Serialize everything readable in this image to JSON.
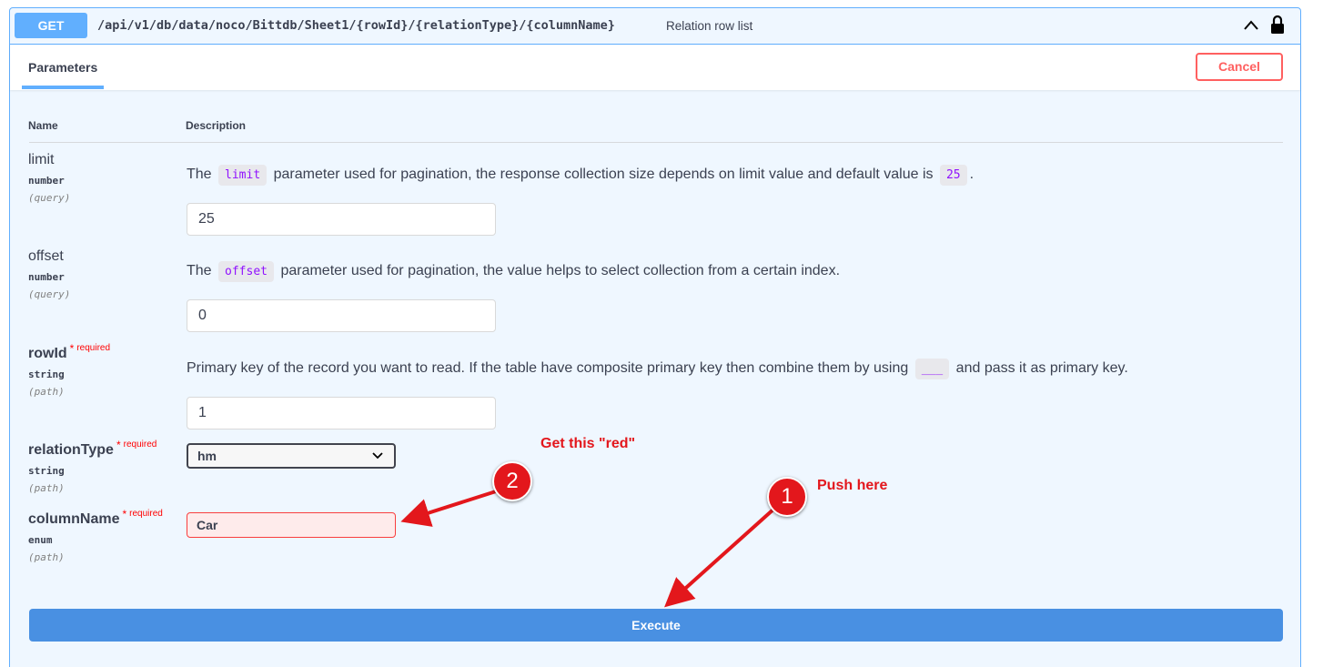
{
  "endpoint": {
    "method": "GET",
    "path": "/api/v1/db/data/noco/Bittdb/Sheet1/{rowId}/{relationType}/{columnName}",
    "summary": "Relation row list"
  },
  "tabs": {
    "parameters": "Parameters"
  },
  "buttons": {
    "cancel": "Cancel",
    "execute": "Execute"
  },
  "table_headers": {
    "name": "Name",
    "description": "Description"
  },
  "required_label": "required",
  "required_star": "*",
  "params": [
    {
      "name": "limit",
      "type": "number",
      "in": "(query)",
      "desc_pre": "The",
      "desc_code": "limit",
      "desc_post": "parameter used for pagination, the response collection size depends on limit value and default value is",
      "desc_code2": "25",
      "desc_end": ".",
      "value": "25"
    },
    {
      "name": "offset",
      "type": "number",
      "in": "(query)",
      "desc_pre": "The",
      "desc_code": "offset",
      "desc_post": "parameter used for pagination, the value helps to select collection from a certain index.",
      "value": "0"
    },
    {
      "name": "rowId",
      "type": "string",
      "in": "(path)",
      "desc_pre": "Primary key of the record you want to read. If the table have composite primary key then combine them by using",
      "desc_code": "___",
      "desc_post": "and pass it as primary key.",
      "value": "1"
    },
    {
      "name": "relationType",
      "type": "string",
      "in": "(path)",
      "selected": "hm"
    },
    {
      "name": "columnName",
      "type": "enum",
      "in": "(path)",
      "value": "Car"
    }
  ],
  "annotations": {
    "note_red": "Get this \"red\"",
    "note_push": "Push here",
    "badge_1": "1",
    "badge_2": "2",
    "arrow_color": "#e3171c"
  },
  "colors": {
    "get_blue": "#61affe",
    "cancel_red": "#ff6060",
    "execute_blue": "#4990e2",
    "code_purple": "#9012fe",
    "error_bg": "#feebeb"
  }
}
